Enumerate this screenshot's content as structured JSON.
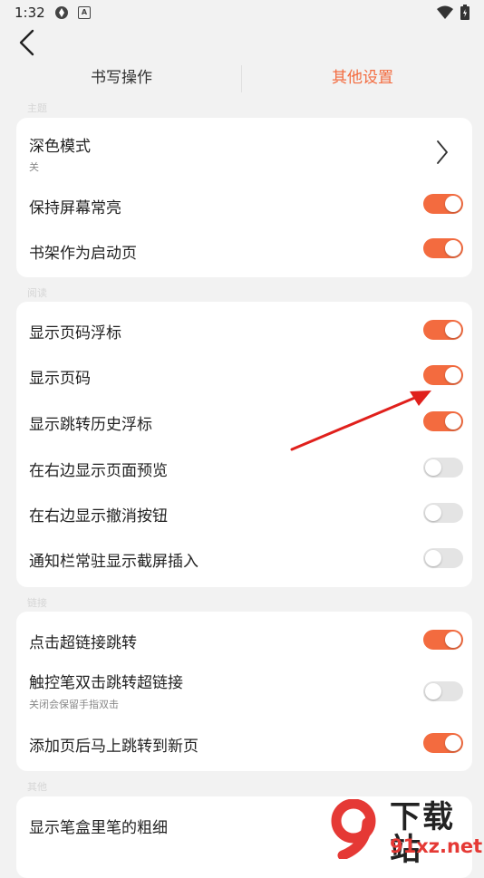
{
  "status_bar": {
    "time": "1:32",
    "icons": [
      "app-icon",
      "a-badge-icon",
      "wifi-icon",
      "battery-icon"
    ],
    "badge_letter": "A"
  },
  "nav": {
    "back_icon": "chevron-left-icon"
  },
  "tabs": [
    {
      "label": "书写操作",
      "active": false
    },
    {
      "label": "其他设置",
      "active": true
    }
  ],
  "sections": [
    {
      "label": "主题",
      "rows": [
        {
          "title": "深色模式",
          "subtitle": "关",
          "control": "chevron"
        },
        {
          "title": "保持屏幕常亮",
          "control": "toggle",
          "on": true
        },
        {
          "title": "书架作为启动页",
          "control": "toggle",
          "on": true
        }
      ]
    },
    {
      "label": "阅读",
      "rows": [
        {
          "title": "显示页码浮标",
          "control": "toggle",
          "on": true
        },
        {
          "title": "显示页码",
          "control": "toggle",
          "on": true
        },
        {
          "title": "显示跳转历史浮标",
          "control": "toggle",
          "on": true
        },
        {
          "title": "在右边显示页面预览",
          "control": "toggle",
          "on": false
        },
        {
          "title": "在右边显示撤消按钮",
          "control": "toggle",
          "on": false
        },
        {
          "title": "通知栏常驻显示截屏插入",
          "control": "toggle",
          "on": false
        }
      ]
    },
    {
      "label": "链接",
      "rows": [
        {
          "title": "点击超链接跳转",
          "control": "toggle",
          "on": true
        },
        {
          "title": "触控笔双击跳转超链接",
          "subtitle": "关闭会保留手指双击",
          "control": "toggle",
          "on": false
        },
        {
          "title": "添加页后马上跳转到新页",
          "control": "toggle",
          "on": true
        }
      ]
    },
    {
      "label": "其他",
      "rows": [
        {
          "title": "显示笔盒里笔的粗细",
          "control": "toggle",
          "on": false
        }
      ]
    }
  ],
  "annotation": {
    "arrow_color": "#e0201c"
  },
  "watermark": {
    "text_cn": "下载站",
    "text_domain": "91xz.net",
    "logo_digit": "9"
  },
  "colors": {
    "accent": "#f36b3f",
    "toggle_off": "#e4e4e4",
    "card": "#ffffff",
    "background": "#f2f2f2"
  }
}
